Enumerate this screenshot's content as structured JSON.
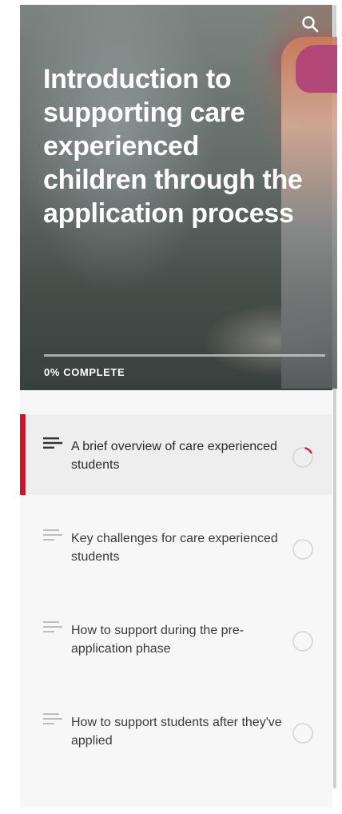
{
  "colors": {
    "accent": "#d0142c",
    "hero_text": "#ffffff",
    "lesson_text": "#3a3a3a",
    "icon_active": "#333333",
    "icon_inactive": "#bdbdbd",
    "circle": "#d4d4d4"
  },
  "header": {
    "search_icon": "search-icon",
    "title": "Introduction to supporting care experienced children through the application process",
    "progress": {
      "percent": 0,
      "label": "0% COMPLETE"
    }
  },
  "lessons": [
    {
      "title": "A brief overview of care experienced students",
      "active": true,
      "status": "in-progress",
      "icon": "lesson-list-icon"
    },
    {
      "title": "Key challenges for care experienced students",
      "active": false,
      "status": "not-started",
      "icon": "lesson-list-icon"
    },
    {
      "title": "How to support during the pre-application phase",
      "active": false,
      "status": "not-started",
      "icon": "lesson-list-icon"
    },
    {
      "title": "How to support students after they've applied",
      "active": false,
      "status": "not-started",
      "icon": "lesson-list-icon"
    }
  ]
}
